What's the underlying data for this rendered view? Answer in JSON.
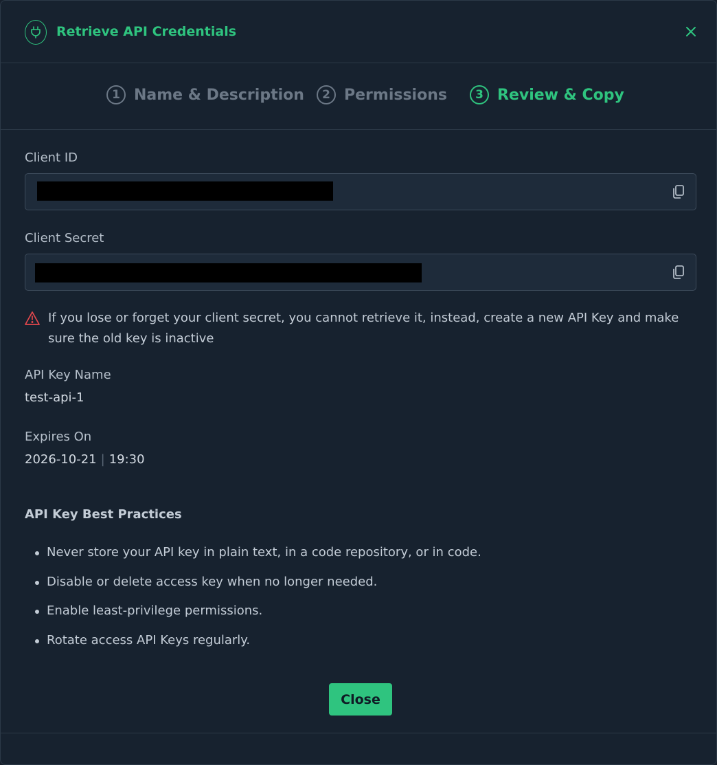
{
  "header": {
    "title": "Retrieve API Credentials",
    "icon": "plug-icon",
    "close_icon": "close-icon"
  },
  "steps": [
    {
      "number": "1",
      "label": "Name & Description",
      "state": "inactive"
    },
    {
      "number": "2",
      "label": "Permissions",
      "state": "inactive"
    },
    {
      "number": "3",
      "label": "Review & Copy",
      "state": "active"
    }
  ],
  "client_id": {
    "label": "Client ID",
    "value_redacted": true
  },
  "client_secret": {
    "label": "Client Secret",
    "value_redacted": true
  },
  "warning": {
    "text": "If you lose or forget your client secret, you cannot retrieve it, instead, create a new API Key and make sure the old key is inactive"
  },
  "api_key_name": {
    "label": "API Key Name",
    "value": "test-api-1"
  },
  "expires_on": {
    "label": "Expires On",
    "date": "2026-10-21",
    "separator": "|",
    "time": "19:30"
  },
  "best_practices": {
    "title": "API Key Best Practices",
    "items": [
      "Never store your API key in plain text, in a code repository, or in code.",
      "Disable or delete access key when no longer needed.",
      "Enable least-privilege permissions.",
      "Rotate access API Keys regularly."
    ]
  },
  "footer": {
    "close_label": "Close"
  },
  "colors": {
    "accent": "#2fc47f",
    "background": "#17222f",
    "warning": "#e5484d"
  }
}
